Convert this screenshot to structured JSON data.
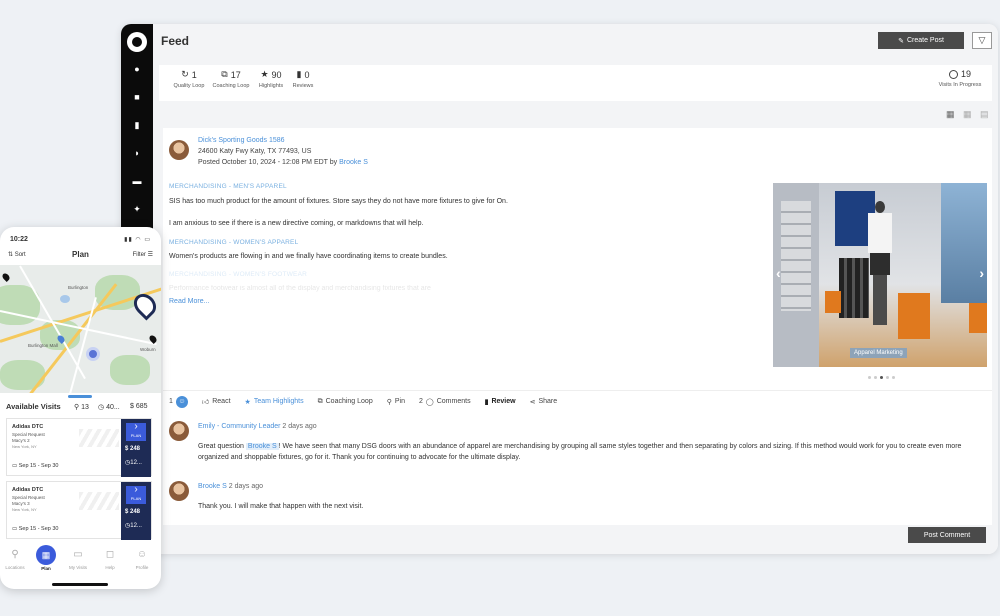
{
  "desktop": {
    "title": "Feed",
    "create_post_label": "Create Post",
    "stats": [
      {
        "icon": "loop-icon",
        "value": "1",
        "label": "Quality Loop"
      },
      {
        "icon": "coaching-icon",
        "value": "17",
        "label": "Coaching Loop"
      },
      {
        "icon": "star-icon",
        "value": "90",
        "label": "Highlights"
      },
      {
        "icon": "bookmark-icon",
        "value": "0",
        "label": "Reviews"
      }
    ],
    "visits_in_progress": {
      "value": "19",
      "label": "Visits In Progress"
    },
    "post": {
      "store": "Dick's Sporting Goods 1586",
      "address": "24600 Katy Fwy Katy, TX 77493, US",
      "posted": "Posted October 10, 2024 - 12:08 PM EDT by",
      "author": "Brooke S",
      "sections": [
        {
          "heading": "MERCHANDISING - MEN'S APPAREL",
          "lines": [
            "SIS has too much product for the amount of fixtures.  Store says they do not have more fixtures to give for On.",
            "I am anxious to see if there is a new directive coming, or markdowns that will help."
          ]
        },
        {
          "heading": "MERCHANDISING - WOMEN'S APPAREL",
          "lines": [
            "Women's products are flowing in and we finally have coordinating items to create bundles."
          ]
        },
        {
          "heading": "MERCHANDISING - WOMEN'S FOOTWEAR",
          "lines": [
            "Performance footwear is almost all of the display and merchandising fixtures that are"
          ]
        }
      ],
      "read_more": "Read More...",
      "photo_tag": "Apparel Marketing",
      "reaction_count": "1",
      "actions": {
        "react": "React",
        "team_highlights": "Team Highlights",
        "coaching_loop": "Coaching Loop",
        "pin": "Pin",
        "comments_count": "2",
        "comments": "Comments",
        "review": "Review",
        "share": "Share"
      }
    },
    "comments": [
      {
        "name": "Emily - Community Leader",
        "ago": "2 days ago",
        "pre": "Great question",
        "mention": "Brooke S",
        "post": "! We have seen that many DSG doors with an abundance of apparel are merchandising by grouping all same styles together and then separating by colors and sizing.  If this method would work for you to create even more organized and shoppable fixtures, go for it.  Thank you for continuing to advocate for the ultimate display."
      },
      {
        "name": "Brooke S",
        "ago": "2 days ago",
        "text": "Thank you.  I will make that happen with the next visit."
      }
    ],
    "post_comment_label": "Post Comment"
  },
  "phone": {
    "time": "10:22",
    "title": "Plan",
    "sort": "Sort",
    "filter": "Filter",
    "map_labels": [
      "Burlington",
      "Burlington Mall",
      "Woburn"
    ],
    "available_visits": "Available Visits",
    "counts": {
      "a": "13",
      "b": "40...",
      "c": "685"
    },
    "visits": [
      {
        "name": "Adidas DTC",
        "type": "Special Request",
        "store": "Macy's 2",
        "location": "New York, NY",
        "plan": "PLAN",
        "amount": "$ 248",
        "hours": "12...",
        "dates": "Sep 15 - Sep 30"
      },
      {
        "name": "Adidas DTC",
        "type": "Special Request",
        "store": "Macy's 3",
        "location": "New York, NY",
        "plan": "PLAN",
        "amount": "$ 248",
        "hours": "12...",
        "dates": "Sep 15 - Sep 30"
      }
    ],
    "tabs": [
      {
        "icon": "location-icon",
        "label": "Locations"
      },
      {
        "icon": "calendar-icon",
        "label": "Plan"
      },
      {
        "icon": "briefcase-icon",
        "label": "My Visits"
      },
      {
        "icon": "chat-icon",
        "label": "Help"
      },
      {
        "icon": "profile-icon",
        "label": "Profile"
      }
    ]
  }
}
